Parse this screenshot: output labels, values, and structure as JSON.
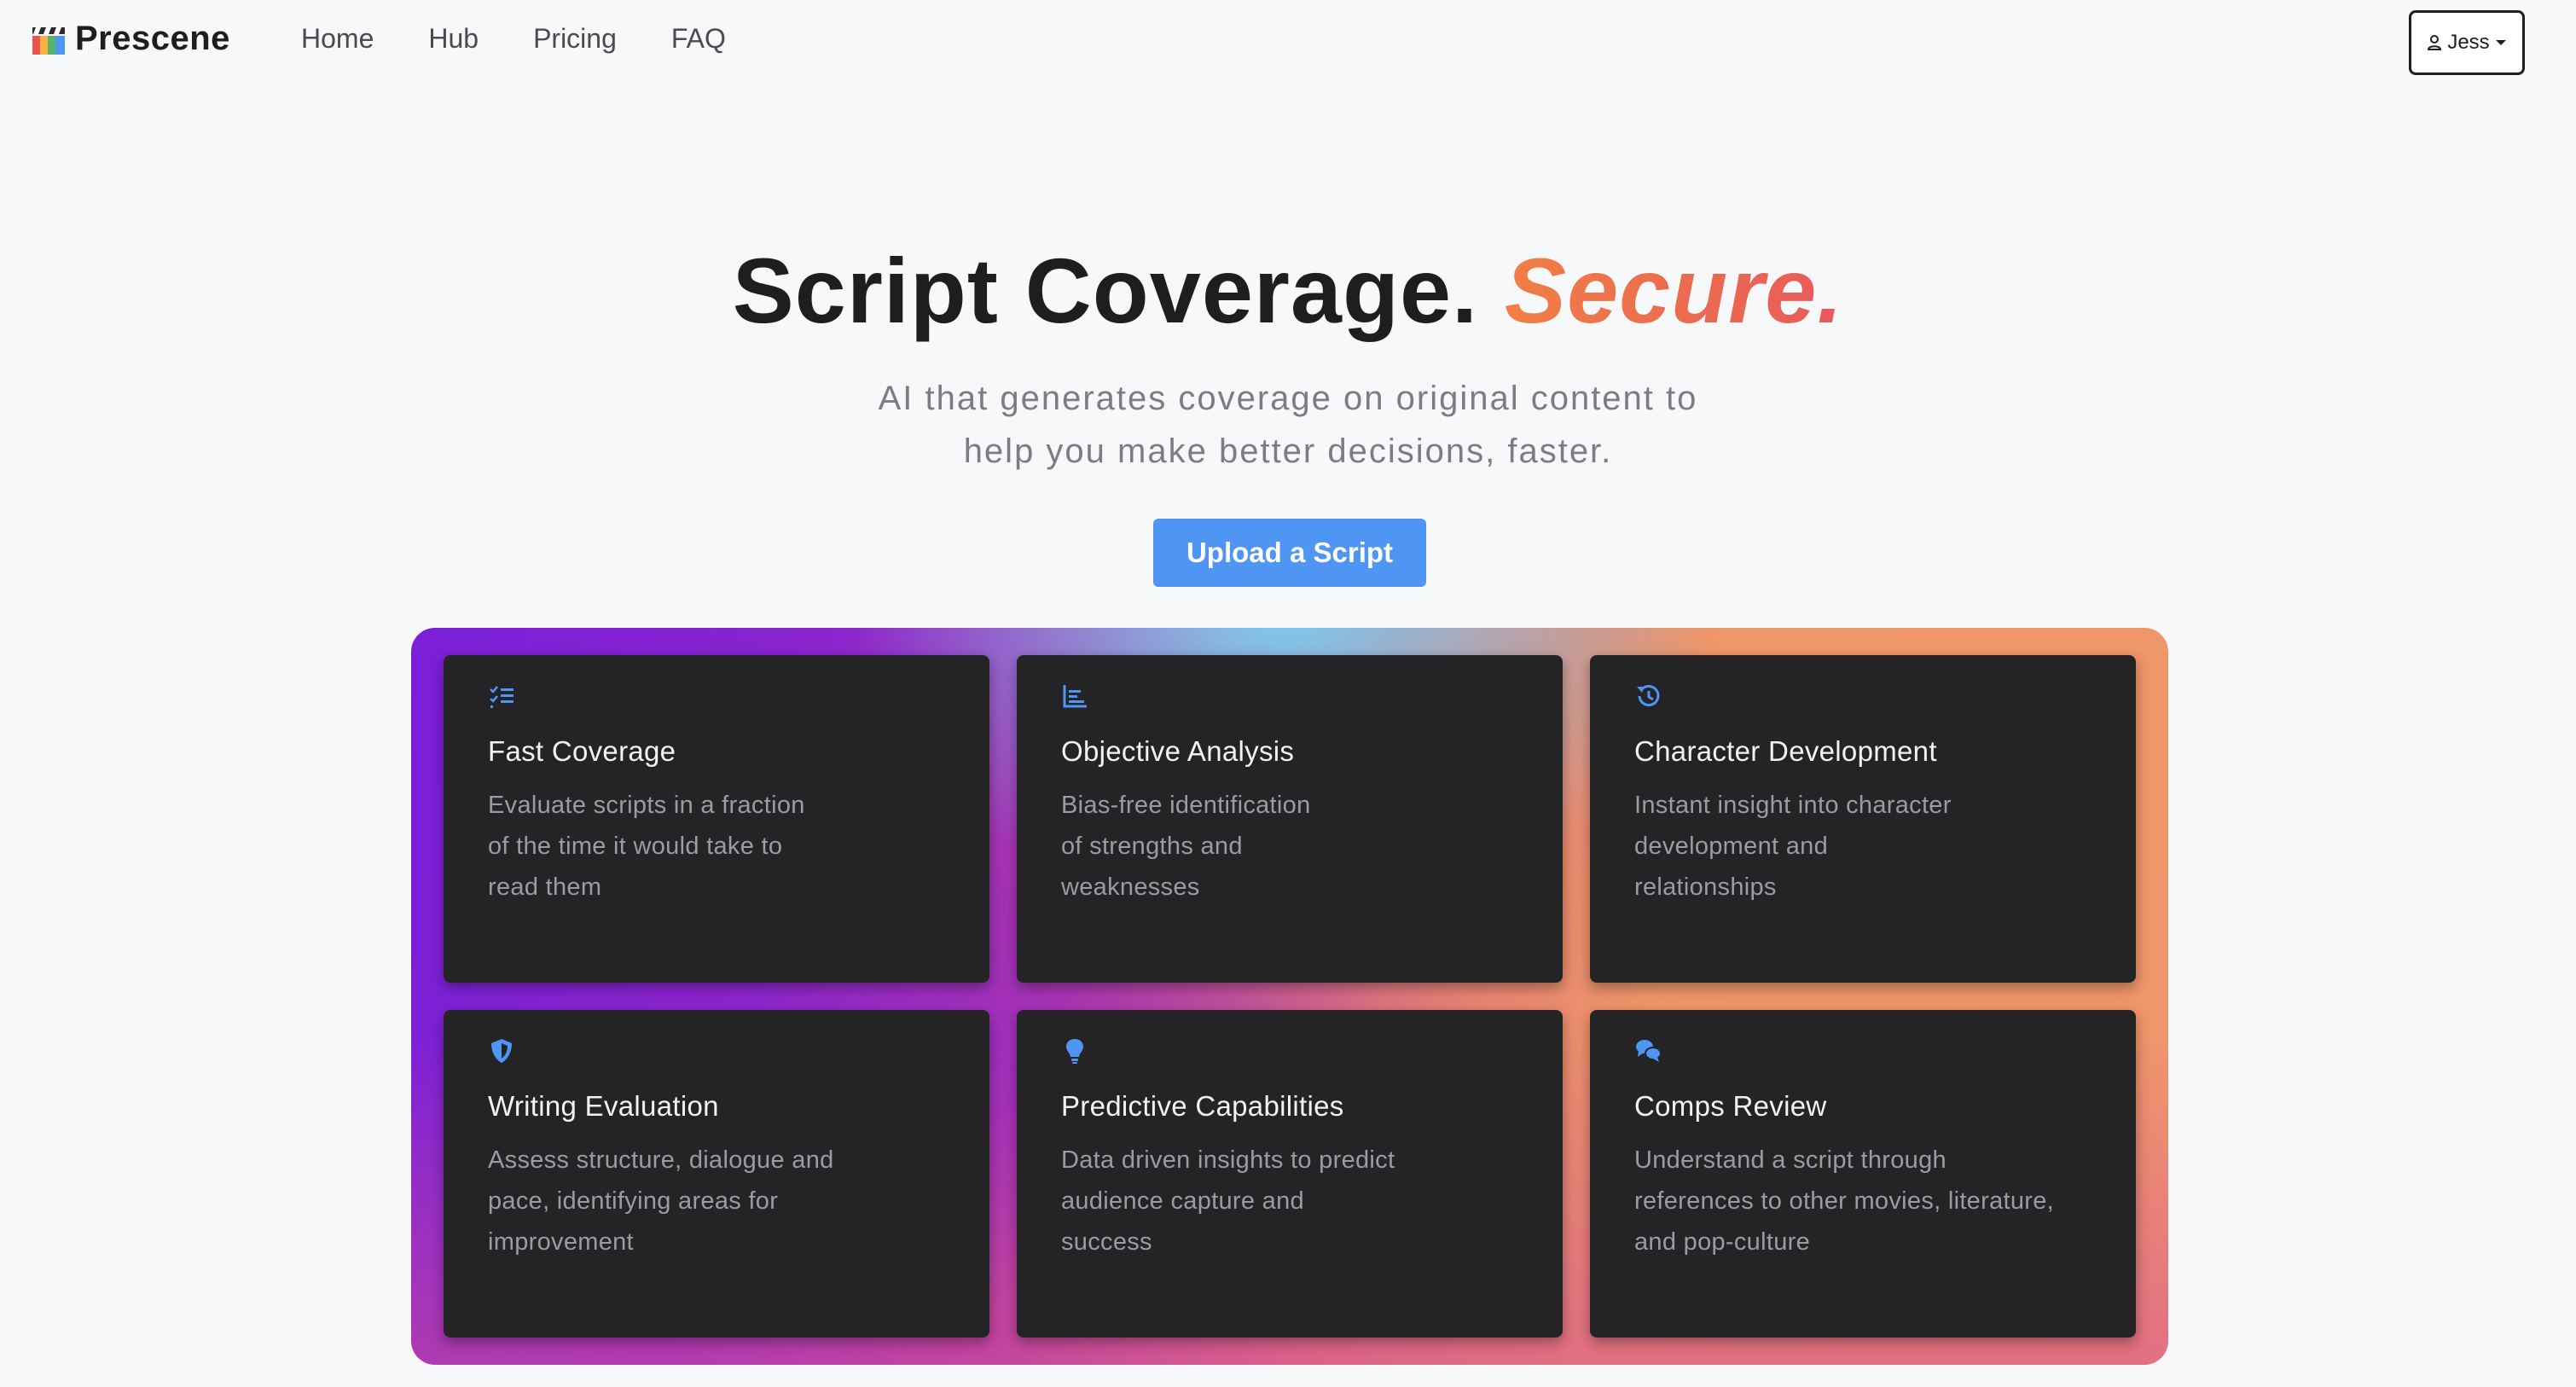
{
  "brand": {
    "name": "Prescene",
    "icon": "clapperboard-icon"
  },
  "nav": {
    "links": [
      "Home",
      "Hub",
      "Pricing",
      "FAQ"
    ]
  },
  "user_menu": {
    "label": "Jess",
    "icon": "user-icon",
    "caret": "caret-down-icon"
  },
  "hero": {
    "title_main": "Script Coverage.",
    "title_accent": "Secure.",
    "subtitle_line1": "AI that generates coverage on original content to",
    "subtitle_line2": "help you make better decisions, faster.",
    "cta_label": "Upload a Script"
  },
  "features": [
    {
      "icon": "checklist-icon",
      "title": "Fast Coverage",
      "desc_lines": [
        "Evaluate scripts in a fraction",
        "of the time it would take to",
        "read them"
      ]
    },
    {
      "icon": "bar-chart-icon",
      "title": "Objective Analysis",
      "desc_lines": [
        "Bias-free identification",
        "of strengths and",
        "weaknesses"
      ]
    },
    {
      "icon": "history-icon",
      "title": "Character Development",
      "desc_lines": [
        "Instant insight into character",
        "development and",
        "relationships"
      ]
    },
    {
      "icon": "shield-icon",
      "title": "Writing Evaluation",
      "desc_lines": [
        "Assess structure, dialogue and",
        "pace, identifying areas for",
        "improvement"
      ]
    },
    {
      "icon": "lightbulb-icon",
      "title": "Predictive Capabilities",
      "desc_lines": [
        "Data driven insights to predict",
        "audience capture and",
        "success"
      ]
    },
    {
      "icon": "chat-bubbles-icon",
      "title": "Comps Review",
      "desc_lines": [
        "Understand a script through",
        "references to other movies, literature,",
        "and pop-culture"
      ]
    }
  ],
  "colors": {
    "accent_blue": "#4f95f3",
    "card_bg": "#242427",
    "icon_blue": "#4f95f3",
    "gradient_purple": "#7a20d8",
    "gradient_orange": "#f0966c"
  }
}
